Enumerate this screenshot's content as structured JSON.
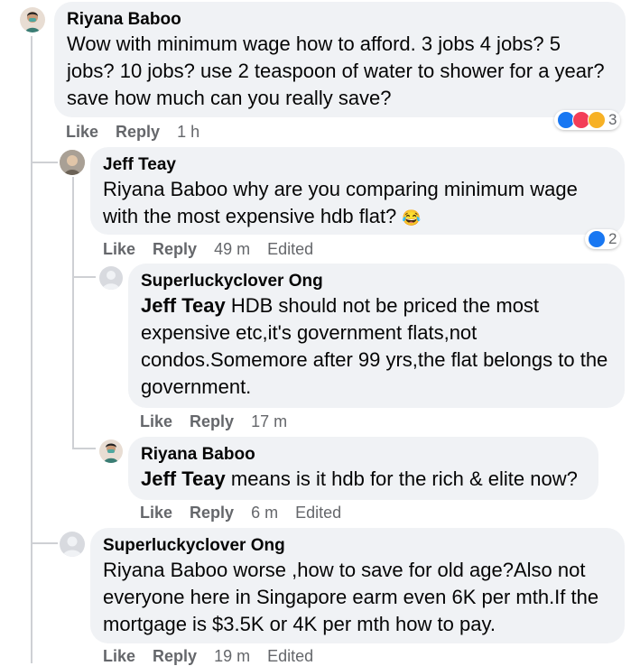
{
  "comments": [
    {
      "author": "Riyana Baboo",
      "text": "Wow with minimum wage how to afford. 3 jobs 4 jobs? 5 jobs? 10 jobs? use 2 teaspoon of water to shower for a year? save how much can you really save?",
      "actions": {
        "like": "Like",
        "reply": "Reply",
        "time": "1 h"
      },
      "reaction_count": "3",
      "reaction_icons": [
        "like-icon",
        "love-icon",
        "haha-icon"
      ]
    },
    {
      "author": "Jeff Teay",
      "mention": "Riyana Baboo",
      "text": " why are you comparing minimum wage with the most expensive hdb flat? ",
      "emoji": "😂",
      "actions": {
        "like": "Like",
        "reply": "Reply",
        "time": "49 m",
        "edited": "Edited"
      },
      "reaction_count": "2",
      "reaction_icons": [
        "like-icon"
      ]
    },
    {
      "author": "Superluckyclover Ong",
      "mention": "Jeff Teay",
      "text": " HDB should not be priced the most expensive etc,it's government flats,not condos.Somemore after 99 yrs,the flat belongs to the government.",
      "actions": {
        "like": "Like",
        "reply": "Reply",
        "time": "17 m"
      }
    },
    {
      "author": "Riyana Baboo",
      "mention": "Jeff Teay",
      "text": " means is it hdb for the rich & elite now?",
      "actions": {
        "like": "Like",
        "reply": "Reply",
        "time": "6 m",
        "edited": "Edited"
      }
    },
    {
      "author": "Superluckyclover Ong",
      "text": "Riyana Baboo worse ,how to save for old age?Also not everyone here in Singapore earm even 6K per mth.If the mortgage is $3.5K or 4K per mth how to pay.",
      "actions": {
        "like": "Like",
        "reply": "Reply",
        "time": "19 m",
        "edited": "Edited"
      }
    }
  ],
  "colors": {
    "bubble": "#f0f2f5",
    "meta": "#65676b",
    "like": "#1877f2",
    "love": "#f33e58",
    "haha": "#f7b125"
  }
}
